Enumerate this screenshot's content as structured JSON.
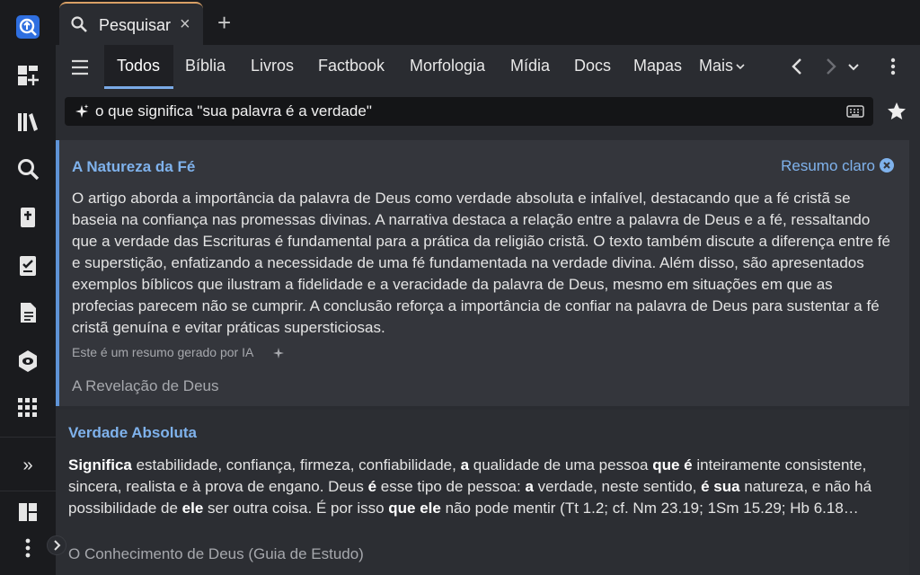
{
  "tabs": {
    "active_title": "Pesquisar",
    "close_glyph": "×",
    "add_glyph": "+"
  },
  "rail": {
    "icons": [
      "app-logo-icon",
      "dashboard-add-icon",
      "library-icon",
      "search-icon",
      "bible-icon",
      "checklist-icon",
      "document-icon",
      "hexagon-eye-icon",
      "apps-grid-icon"
    ],
    "expand_glyph": "»",
    "bottom_icons": [
      "layout-icon",
      "more-vertical-icon"
    ]
  },
  "nav": {
    "tabs": [
      "Todos",
      "Bíblia",
      "Livros",
      "Factbook",
      "Morfologia",
      "Mídia",
      "Docs",
      "Mapas",
      "Mais"
    ],
    "active": "Todos"
  },
  "search": {
    "query": "o que significa \"sua palavra é a verdade\""
  },
  "results": [
    {
      "title": "A Natureza da Fé",
      "action": "Resumo claro",
      "body": "O artigo aborda a importância da palavra de Deus como verdade absoluta e infalível, destacando que a fé cristã se baseia na confiança nas promessas divinas. A narrativa destaca a relação entre a palavra de Deus e a fé, ressaltando que a verdade das Escrituras é fundamental para a prática da religião cristã. O texto também discute a diferença entre fé e superstição, enfatizando a necessidade de uma fé fundamentada na verdade divina. Além disso, são apresentados exemplos bíblicos que ilustram a fidelidade e a veracidade da palavra de Deus, mesmo em situações em que as profecias parecem não se cumprir. A conclusão reforça a importância de confiar na palavra de Deus para sustentar a fé cristã genuína e evitar práticas supersticiosas.",
      "ai_note": "Este é um resumo gerado por IA",
      "source": "A Revelação de Deus"
    },
    {
      "title": "Verdade Absoluta",
      "segments": [
        {
          "t": "Significa",
          "b": true
        },
        {
          "t": " estabilidade, confiança, firmeza, confiabilidade, ",
          "b": false
        },
        {
          "t": "a",
          "b": true
        },
        {
          "t": " qualidade de uma pessoa ",
          "b": false
        },
        {
          "t": "que é",
          "b": true
        },
        {
          "t": " inteiramente consistente, sincera, realista e à prova de engano. Deus ",
          "b": false
        },
        {
          "t": "é",
          "b": true
        },
        {
          "t": " esse tipo de pessoa: ",
          "b": false
        },
        {
          "t": "a",
          "b": true
        },
        {
          "t": " verdade, neste sentido, ",
          "b": false
        },
        {
          "t": "é sua",
          "b": true
        },
        {
          "t": " natureza, e não há possibilidade de ",
          "b": false
        },
        {
          "t": "ele",
          "b": true
        },
        {
          "t": " ser outra coisa. É por isso ",
          "b": false
        },
        {
          "t": "que ele",
          "b": true
        },
        {
          "t": " não pode mentir (Tt 1.2; cf. Nm 23.19; 1Sm 15.29; Hb 6.18…",
          "b": false
        }
      ],
      "source": "O Conhecimento de Deus (Guia de Estudo)"
    }
  ],
  "colors": {
    "accent": "#7fb2ec",
    "tab_highlight": "#d9a066",
    "logo": "#2f6fe0"
  }
}
